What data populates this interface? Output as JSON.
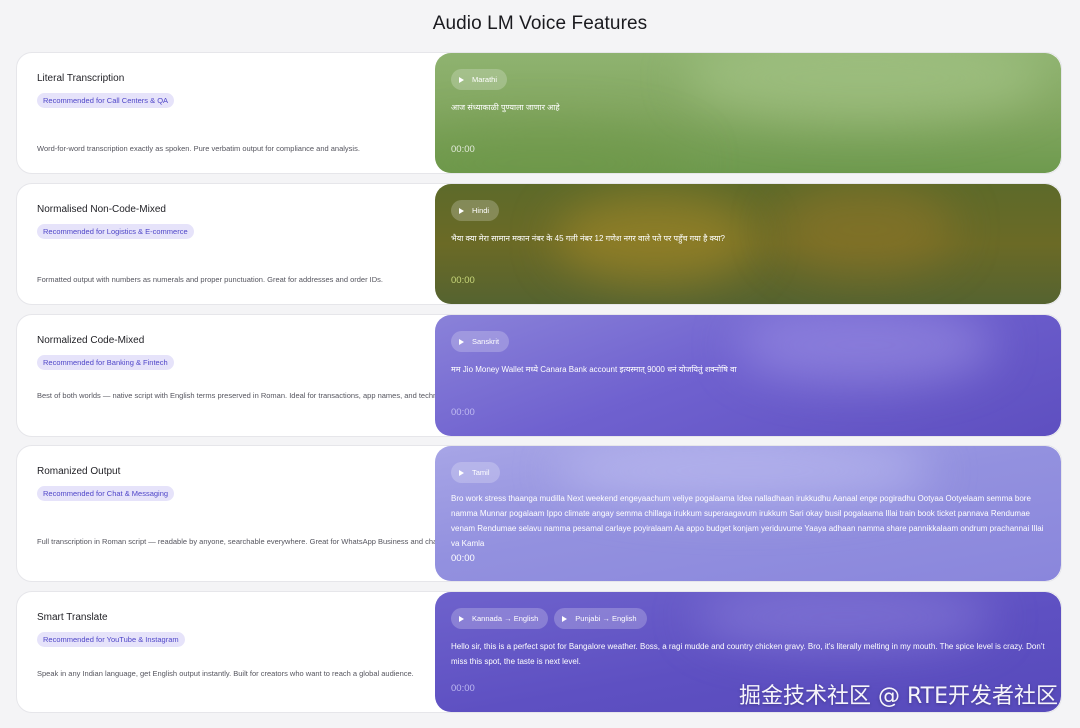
{
  "page": {
    "title": "Audio LM Voice Features"
  },
  "features": [
    {
      "title": "Literal Transcription",
      "badge": "Recommended for Call Centers & QA",
      "description": "Word-for-word transcription exactly as spoken. Pure verbatim output for compliance and analysis.",
      "chips": [
        "Marathi"
      ],
      "transcript": "आज संध्याकाळी पुण्याला जाणार आहे",
      "time": "00:00"
    },
    {
      "title": "Normalised Non-Code-Mixed",
      "badge": "Recommended for Logistics & E-commerce",
      "description": "Formatted output with numbers as numerals and proper punctuation. Great for addresses and order IDs.",
      "chips": [
        "Hindi"
      ],
      "transcript": "भैया क्या मेरा सामान मकान नंबर के 45 गली नंबर 12 गणेश नगर वाले पते पर पहुँच गया है क्या?",
      "time": "00:00"
    },
    {
      "title": "Normalized Code-Mixed",
      "badge": "Recommended for Banking & Fintech",
      "description": "Best of both worlds — native script with English terms preserved in Roman. Ideal for transactions, app names, and technical conversations.",
      "chips": [
        "Sanskrit"
      ],
      "transcript": "मम Jio Money Wallet मध्ये Canara Bank account इत्यस्मात् 9000 धनं योजयितुं शक्नोषि वा",
      "time": "00:00"
    },
    {
      "title": "Romanized Output",
      "badge": "Recommended for Chat & Messaging",
      "description": "Full transcription in Roman script — readable by anyone, searchable everywhere. Great for WhatsApp Business and chat support.",
      "chips": [
        "Tamil"
      ],
      "transcript": "Bro work stress thaanga mudilla Next weekend engeyaachum veliye pogalaama Idea nalladhaan irukkudhu Aanaal enge pogiradhu Ootyaa Ootyelaam semma bore namma Munnar pogalaam Ippo climate angay semma chillaga irukkum superaagavum irukkum Sari okay busil pogalaama Illai train book ticket pannava Rendumae venam Rendumae selavu namma pesamal carlaye poyiralaam Aa appo budget konjam yeriduvume Yaaya adhaan namma share pannikkalaam ondrum prachannai Illai va Kamla",
      "time": "00:00"
    },
    {
      "title": "Smart Translate",
      "badge": "Recommended for YouTube & Instagram",
      "description": "Speak in any Indian language, get English output instantly. Built for creators who want to reach a global audience.",
      "chips": [
        "Kannada → English",
        "Punjabi → English"
      ],
      "transcript": "Hello sir, this is a perfect spot for Bangalore weather. Boss, a ragi mudde and country chicken gravy. Bro, it's literally melting in my mouth. The spice level is crazy. Don't miss this spot, the taste is next level.",
      "time": "00:00"
    }
  ],
  "watermark": "掘金技术社区 @ RTE开发者社区"
}
